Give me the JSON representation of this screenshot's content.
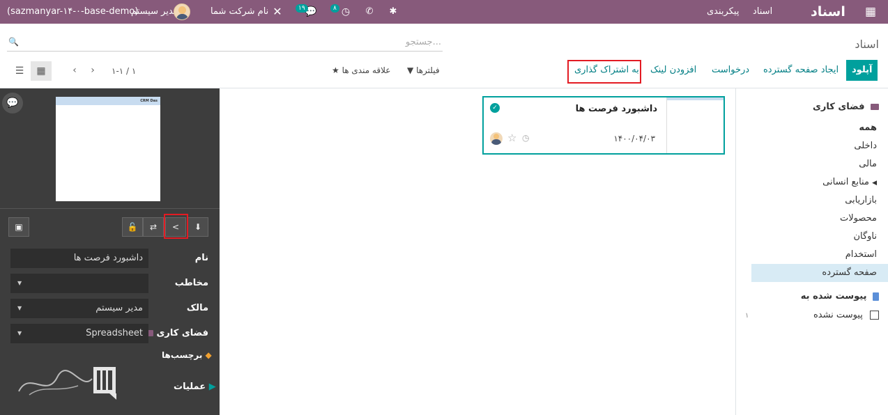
{
  "navbar": {
    "brand": "اسناد",
    "menu": [
      "اسناد",
      "پیکربندی"
    ],
    "company": "نام شرکت شما",
    "user": "مدیر سیستم",
    "db": "(sazmanyar-۱۴-۰-base-demo)",
    "messages_count": "۱۹",
    "activities_count": "۸"
  },
  "control_panel": {
    "breadcrumb": "اسناد",
    "search_placeholder": "جستجو...",
    "buttons": {
      "upload": "آپلود",
      "create_spreadsheet": "ایجاد صفحه گسترده",
      "request": "درخواست",
      "add_link": "افزودن لینک",
      "share": "به اشتراک گذاری"
    },
    "filters": "فیلترها",
    "favorites": "علاقه مندی ها",
    "pager": "۱-۱ / ۱"
  },
  "sidebar": {
    "workspace_heading": "فضای کاری",
    "workspaces": [
      "همه",
      "داخلی",
      "مالی",
      "منابع انسانی",
      "بازاریابی",
      "محصولات",
      "ناوگان",
      "استخدام",
      "صفحه گسترده"
    ],
    "attached_heading": "پیوست شده به",
    "not_attached": "پیوست نشده",
    "not_attached_count": "۱"
  },
  "card": {
    "title": "داشبورد فرصت ها",
    "date": "۱۴۰۰/۰۴/۰۳"
  },
  "inspector": {
    "thumb_header": "CRM Das",
    "fields": {
      "name_label": "نام",
      "name_value": "داشبورد فرصت ها",
      "contact_label": "مخاطب",
      "contact_value": "",
      "owner_label": "مالک",
      "owner_value": "مدیر سیستم",
      "workspace_label": "فضای کاری",
      "workspace_value": "Spreadsheet"
    },
    "tags_label": "برچسب‌ها",
    "operations_label": "عملیات"
  },
  "colors": {
    "brand": "#875A7B",
    "primary": "#00A09D",
    "highlight": "#e31b23",
    "dark_pane": "#3d3d3d"
  }
}
